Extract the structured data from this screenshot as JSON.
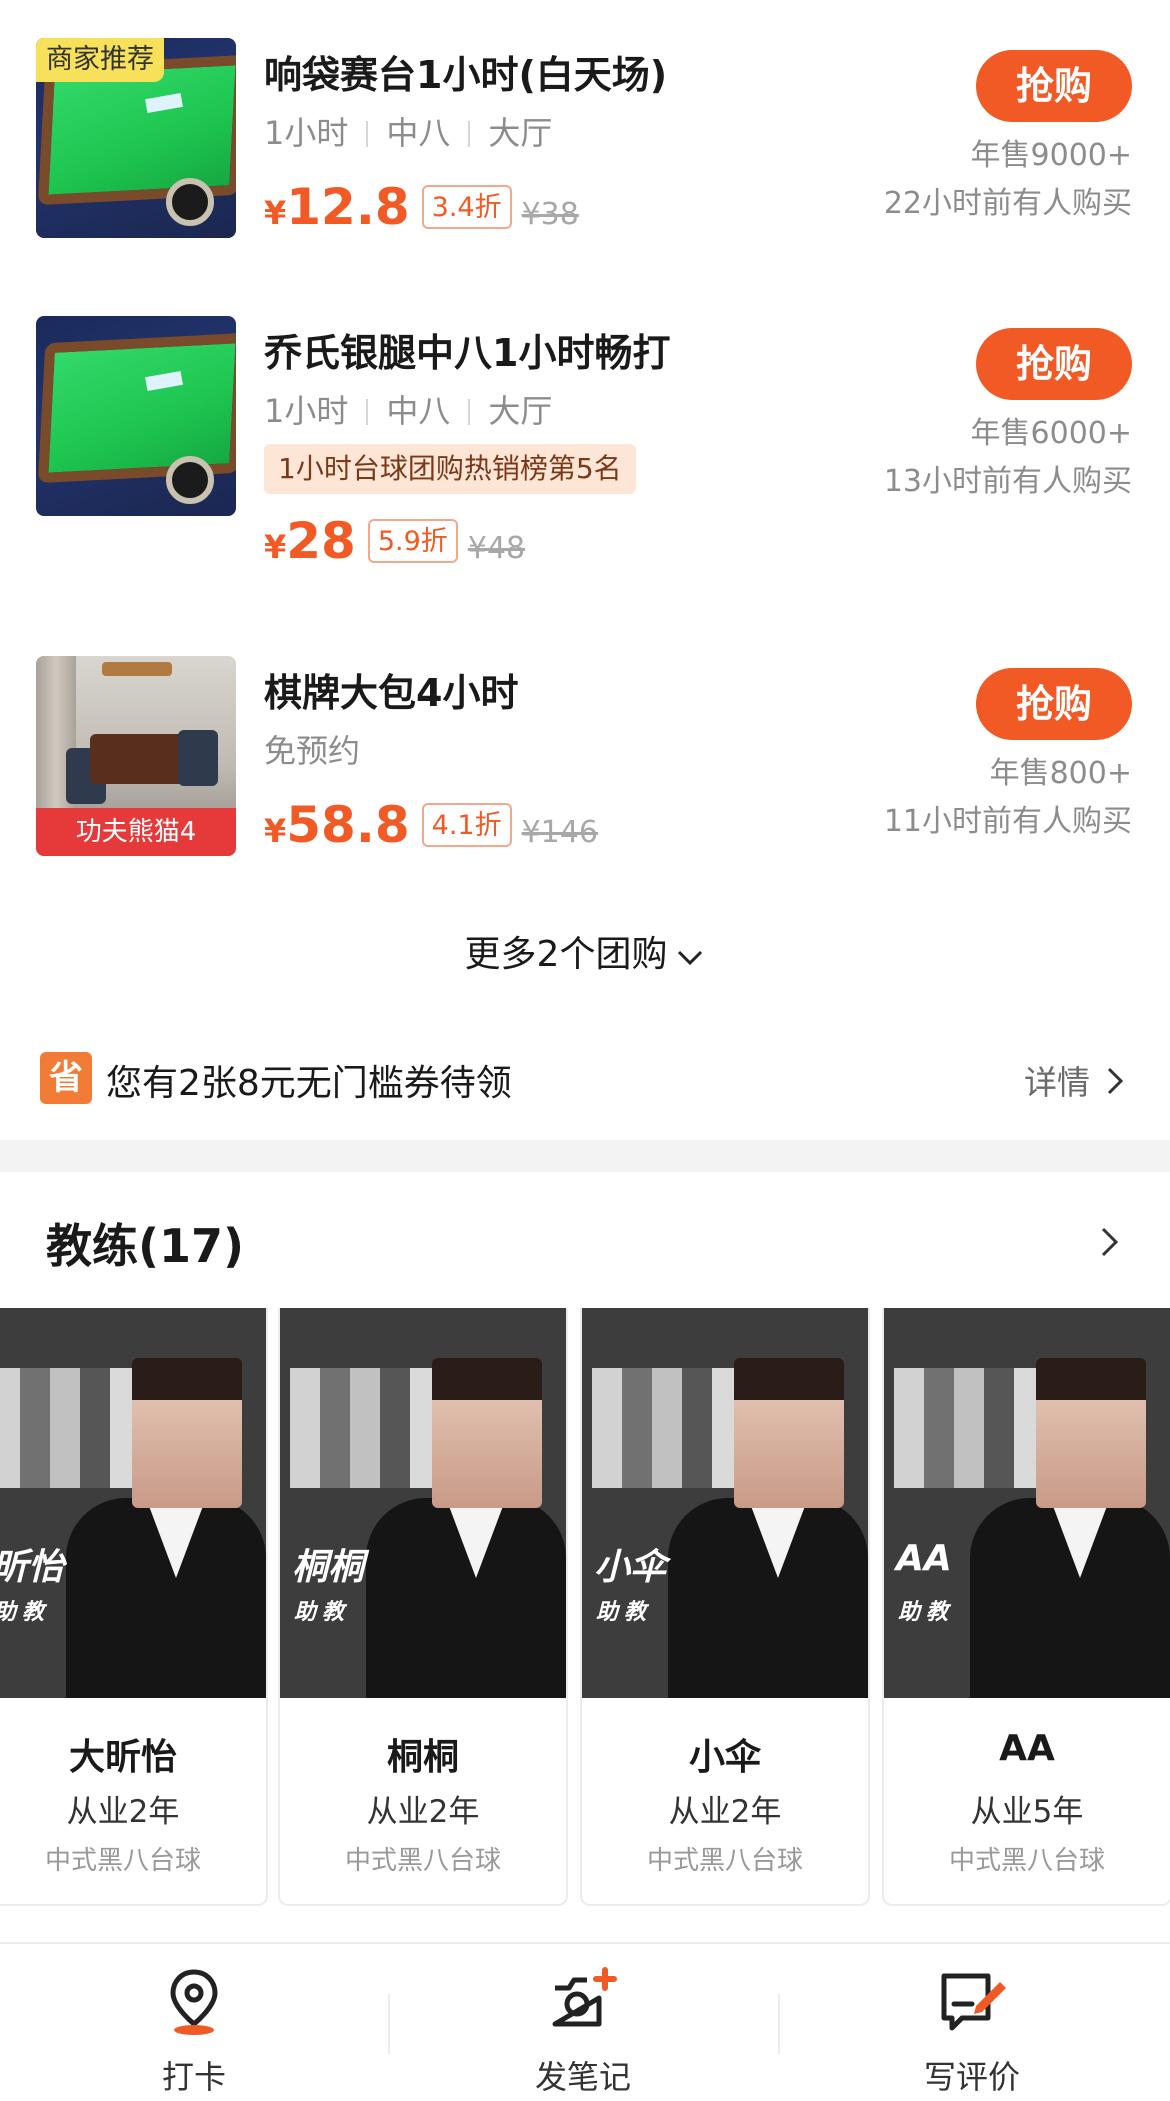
{
  "deals": [
    {
      "badge": "商家推荐",
      "title": "响袋赛台1小时(白天场)",
      "tags": [
        "1小时",
        "中八",
        "大厅"
      ],
      "rank": "",
      "price_symbol": "¥",
      "price": "12.8",
      "discount": "3.4折",
      "original": "¥38",
      "buy_label": "抢购",
      "sold": "年售9000+",
      "recent": "22小时前有人购买"
    },
    {
      "badge": "",
      "title": "乔氏银腿中八1小时畅打",
      "tags": [
        "1小时",
        "中八",
        "大厅"
      ],
      "rank": "1小时台球团购热销榜第5名",
      "price_symbol": "¥",
      "price": "28",
      "discount": "5.9折",
      "original": "¥48",
      "buy_label": "抢购",
      "sold": "年售6000+",
      "recent": "13小时前有人购买"
    },
    {
      "badge": "功夫熊猫4",
      "title": "棋牌大包4小时",
      "tags": [
        "免预约"
      ],
      "rank": "",
      "price_symbol": "¥",
      "price": "58.8",
      "discount": "4.1折",
      "original": "¥146",
      "buy_label": "抢购",
      "sold": "年售800+",
      "recent": "11小时前有人购买"
    }
  ],
  "more": {
    "label": "更多2个团购",
    "icon": "chevron-down-icon"
  },
  "coupon": {
    "icon_text": "省",
    "text": "您有2张8元无门槛券待领",
    "detail": "详情",
    "accent": "#f27b35"
  },
  "coaches_section": {
    "title": "教练(17)"
  },
  "coaches": [
    {
      "brand": "昕怡",
      "role": "助教",
      "name": "大昕怡",
      "years": "从业2年",
      "specialty": "中式黑八台球"
    },
    {
      "brand": "桐桐",
      "role": "助教",
      "name": "桐桐",
      "years": "从业2年",
      "specialty": "中式黑八台球"
    },
    {
      "brand": "小伞",
      "role": "助教",
      "name": "小伞",
      "years": "从业2年",
      "specialty": "中式黑八台球"
    },
    {
      "brand": "AA",
      "role": "助教",
      "name": "AA",
      "years": "从业5年",
      "specialty": "中式黑八台球"
    }
  ],
  "bottom_bar": {
    "checkin": {
      "label": "打卡",
      "icon": "location-pin-icon"
    },
    "note": {
      "label": "发笔记",
      "icon": "camera-plus-icon"
    },
    "review": {
      "label": "写评价",
      "icon": "edit-review-icon"
    }
  },
  "colors": {
    "accent": "#f15a24",
    "rank_bg": "#fde6d6",
    "badge_yellow": "#f7e05a",
    "badge_red": "#e63a3a"
  }
}
